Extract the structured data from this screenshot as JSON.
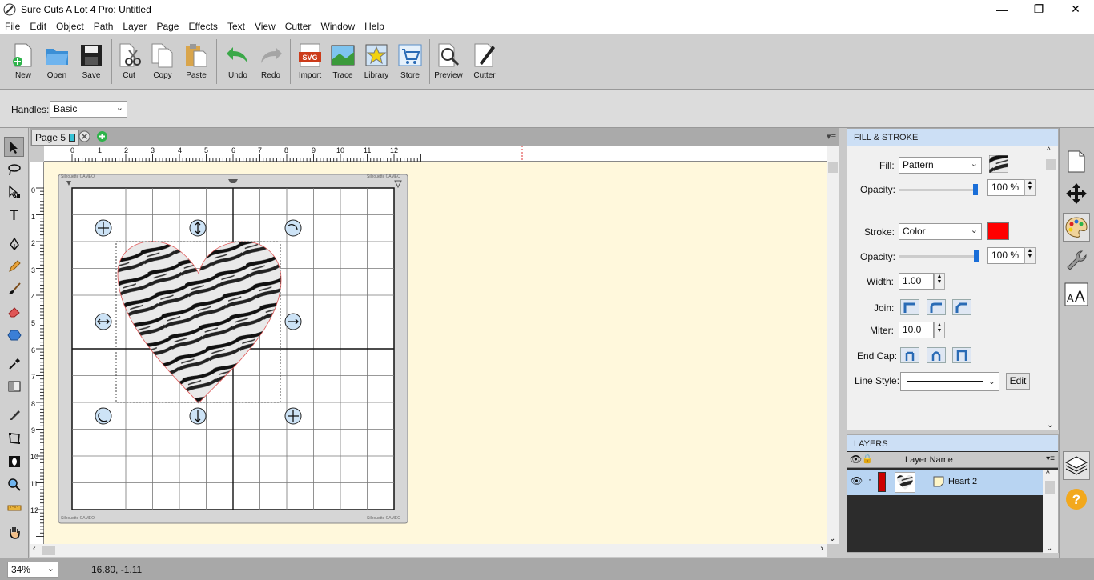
{
  "window": {
    "title": "Sure Cuts A Lot 4 Pro: Untitled",
    "min": "—",
    "max": "❐",
    "close": "✕"
  },
  "menu": [
    "File",
    "Edit",
    "Object",
    "Path",
    "Layer",
    "Page",
    "Effects",
    "Text",
    "View",
    "Cutter",
    "Window",
    "Help"
  ],
  "toolbar": {
    "buttons": [
      "New",
      "Open",
      "Save",
      "Cut",
      "Copy",
      "Paste",
      "Undo",
      "Redo",
      "Import",
      "Trace",
      "Library",
      "Store",
      "Preview",
      "Cutter"
    ]
  },
  "options": {
    "handles_label": "Handles:",
    "handles_value": "Basic"
  },
  "page_tab": {
    "label": "Page 5"
  },
  "ruler": {
    "h": [
      "0",
      "1",
      "2",
      "3",
      "4",
      "5",
      "6",
      "7",
      "8",
      "9",
      "10",
      "11",
      "12"
    ],
    "v": [
      "0",
      "1",
      "2",
      "3",
      "4",
      "5",
      "6",
      "7",
      "8",
      "9",
      "10",
      "11",
      "12"
    ]
  },
  "mat": {
    "corner_text": "Silhouette CAMEO"
  },
  "fill_stroke": {
    "header": "FILL & STROKE",
    "fill_label": "Fill:",
    "fill_value": "Pattern",
    "opacity_label": "Opacity:",
    "fill_opacity": "100 %",
    "stroke_label": "Stroke:",
    "stroke_value": "Color",
    "stroke_color": "#ff0000",
    "stroke_opacity": "100 %",
    "width_label": "Width:",
    "width_value": "1.00",
    "join_label": "Join:",
    "miter_label": "Miter:",
    "miter_value": "10.0",
    "endcap_label": "End Cap:",
    "linestyle_label": "Line Style:",
    "edit_label": "Edit"
  },
  "layers": {
    "header": "LAYERS",
    "column": "Layer Name",
    "rows": [
      {
        "name": "Heart 2",
        "color": "#cc0000"
      }
    ]
  },
  "status": {
    "zoom": "34%",
    "coords": "16.80, -1.11"
  },
  "colors": {
    "selection": "#1a66cc",
    "accent_green": "#2db34a"
  }
}
